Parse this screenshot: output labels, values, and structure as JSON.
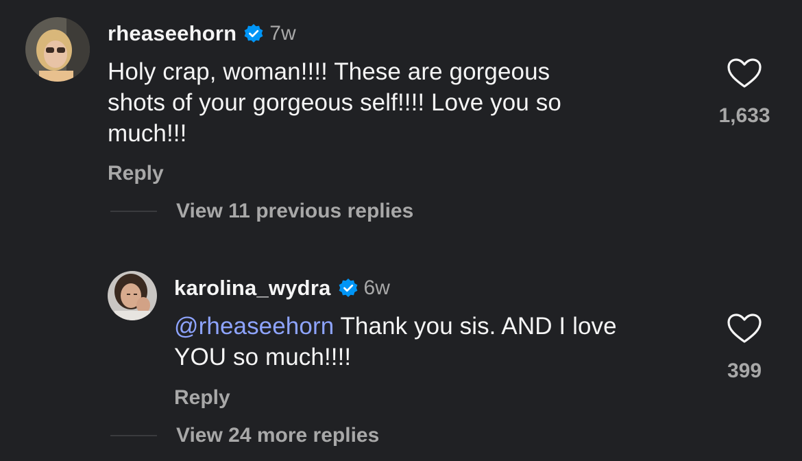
{
  "comments": [
    {
      "username": "rheaseehorn",
      "time": "7w",
      "mention": "",
      "text": "Holy crap, woman!!!! These are gorgeous shots of your gorgeous self!!!! Love you so much!!!",
      "text_lines": [
        "Holy crap, woman!!!! These are gorgeous",
        "shots of your gorgeous self!!!! Love you so",
        "much!!!"
      ],
      "likes": "1,633",
      "reply_label": "Reply",
      "view_replies": "View 11 previous replies"
    },
    {
      "username": "karolina_wydra",
      "time": "6w",
      "mention": "@rheaseehorn",
      "text_line_1_rest": " Thank you sis. AND I love",
      "text_line_2": "YOU so much!!!!",
      "likes": "399",
      "reply_label": "Reply",
      "view_replies": "View 24 more replies"
    }
  ],
  "icons": {
    "verified": "verified-badge-icon",
    "like": "heart-icon"
  },
  "colors": {
    "background": "#202124",
    "text": "#f5f5f5",
    "muted": "#a8a8a8",
    "mention": "#8ea4ff",
    "verified": "#0095f6"
  }
}
